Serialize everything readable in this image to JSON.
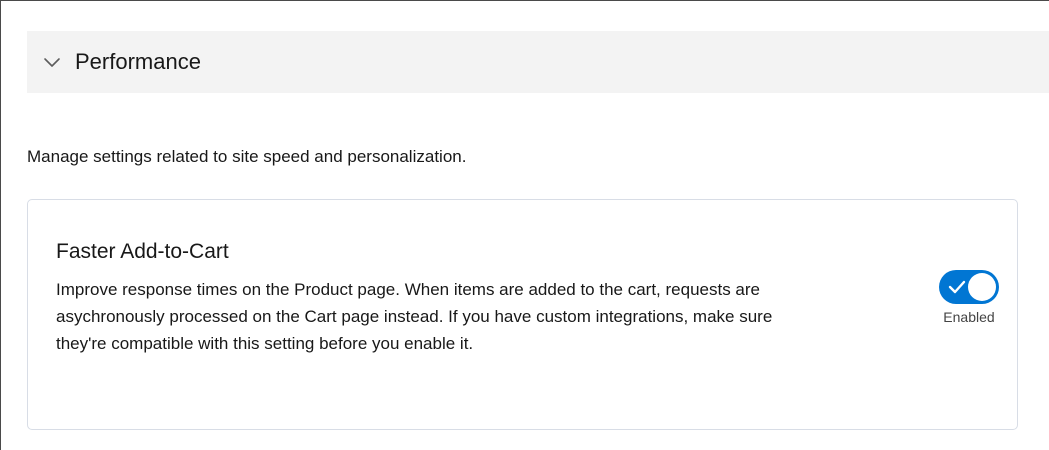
{
  "section": {
    "title": "Performance",
    "expanded": true,
    "chevron_icon": "chevron-down-icon"
  },
  "description": "Manage settings related to site speed and personalization.",
  "setting": {
    "title": "Faster Add-to-Cart",
    "body": "Improve response times on the Product page. When items are added to the cart, requests are asychronously processed on the Cart page instead. If you have custom integrations, make sure they're compatible with this setting before you enable it.",
    "toggle": {
      "checked": true,
      "status_label": "Enabled",
      "check_icon": "check-icon",
      "color": "#0176d3"
    }
  }
}
